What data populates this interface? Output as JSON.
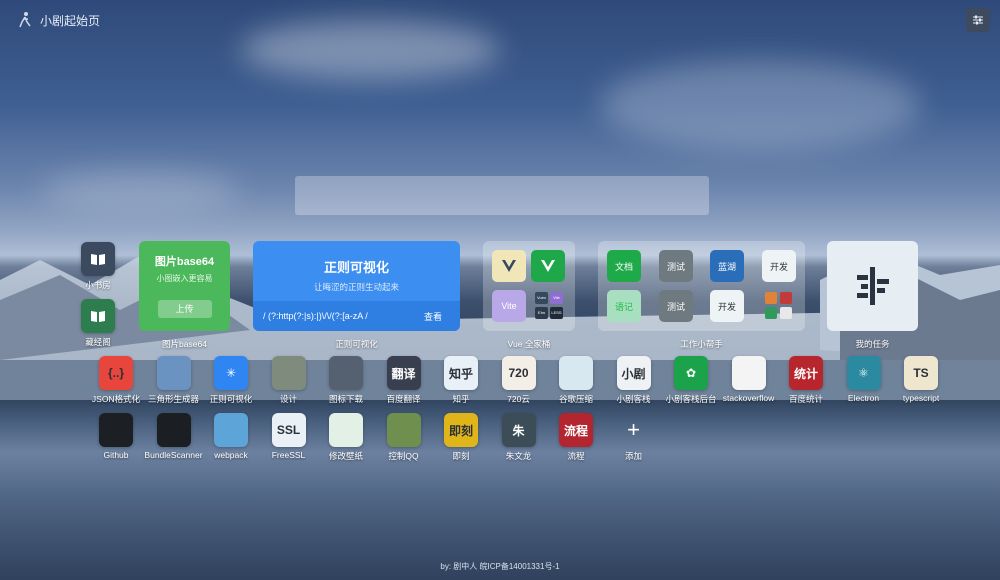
{
  "header": {
    "title": "小剧起始页",
    "logo_icon": "runner-logo-icon",
    "settings_icon": "sliders-icon"
  },
  "search": {
    "placeholder": ""
  },
  "row1": {
    "left_col": [
      {
        "label": "小书房",
        "icon": "book-icon",
        "color": "#3b4a5e"
      },
      {
        "label": "藏经阁",
        "icon": "book-icon",
        "color": "#2e7d4f"
      }
    ],
    "base64": {
      "title": "图片base64",
      "subtitle": "小图嵌入更容易",
      "button": "上传",
      "label": "图片base64"
    },
    "regex": {
      "title": "正则可视化",
      "subtitle": "让晦涩的正则生动起来",
      "expr": "/ (?:http(?:|s):|)\\/\\/(?:[a-zA /",
      "view": "查看",
      "label": "正则可视化"
    },
    "vue": {
      "label": "Vue 全家桶",
      "items": [
        "",
        "",
        "Vite",
        "Vuex",
        "Vite",
        "Elm",
        "Ele",
        "LESS"
      ]
    },
    "helper": {
      "label": "工作小帮手",
      "items": [
        "文档",
        "测试",
        "蓝湖",
        "开发",
        "语记",
        "测试",
        "开发",
        ""
      ]
    },
    "tasks": {
      "label": "我的任务",
      "icon": "kanban-icon"
    }
  },
  "row2": [
    {
      "label": "JSON格式化",
      "text": "{..}",
      "color": "#e8453c"
    },
    {
      "label": "三角形生成器",
      "text": "",
      "color": "#6a93c2"
    },
    {
      "label": "正则可视化",
      "text": "✳",
      "color": "#2f86f2"
    },
    {
      "label": "设计",
      "text": "",
      "color": "#7f8b7c"
    },
    {
      "label": "图标下载",
      "text": "",
      "color": "#556070"
    },
    {
      "label": "百度翻译",
      "text": "翻译",
      "color": "#3a3f4f"
    },
    {
      "label": "知乎",
      "text": "知乎",
      "color": "#e9f1f8"
    },
    {
      "label": "720云",
      "text": "720",
      "color": "#f3efe7"
    },
    {
      "label": "谷歌压缩",
      "text": "",
      "color": "#d7e8f1"
    },
    {
      "label": "小剧客栈",
      "text": "小剧",
      "color": "#eef2f5"
    },
    {
      "label": "小剧客栈后台",
      "text": "✿",
      "color": "#1aa34a"
    },
    {
      "label": "stackoverflow",
      "text": "",
      "color": "#f4f4f4"
    },
    {
      "label": "百度统计",
      "text": "统计",
      "color": "#b8262d"
    },
    {
      "label": "Electron",
      "text": "⚛",
      "color": "#2c8aa0"
    },
    {
      "label": "typescript",
      "text": "TS",
      "color": "#efe6cf"
    }
  ],
  "row3": [
    {
      "label": "Github",
      "text": "",
      "color": "#1c1f24"
    },
    {
      "label": "BundleScanner",
      "text": "",
      "color": "#1b1e23"
    },
    {
      "label": "webpack",
      "text": "",
      "color": "#5da4d8"
    },
    {
      "label": "FreeSSL",
      "text": "SSL",
      "color": "#e9f1f7"
    },
    {
      "label": "修改壁纸",
      "text": "",
      "color": "#e3f0e6"
    },
    {
      "label": "控制QQ",
      "text": "",
      "color": "#6f8f4f"
    },
    {
      "label": "即刻",
      "text": "即刻",
      "color": "#e0b51a"
    },
    {
      "label": "朱文龙",
      "text": "朱",
      "color": "#3d4d57"
    },
    {
      "label": "流程",
      "text": "流程",
      "color": "#b3262f"
    },
    {
      "label": "添加",
      "text": "+",
      "color": "transparent"
    }
  ],
  "footer": "by: 剧中人    皖ICP备14001331号-1"
}
